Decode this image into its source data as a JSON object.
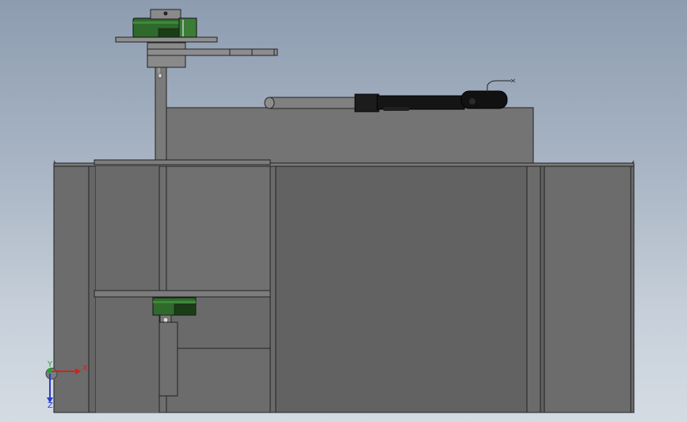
{
  "viewport": {
    "background_top": "#8d9cb0",
    "background_bottom": "#d4dbe3"
  },
  "model": {
    "frame_color": "#6e6e6e",
    "panel_color": "#626262",
    "upper_housing_color": "#747474",
    "motor_green": "#2f6a2c",
    "actuator_black": "#161616",
    "edge_color": "#1e1e1e"
  },
  "triad": {
    "x_label": "X",
    "y_label": "Y",
    "z_label": "Z",
    "x_color": "#d42020",
    "y_color": "#1fa42c",
    "z_color": "#2a3bd0"
  }
}
